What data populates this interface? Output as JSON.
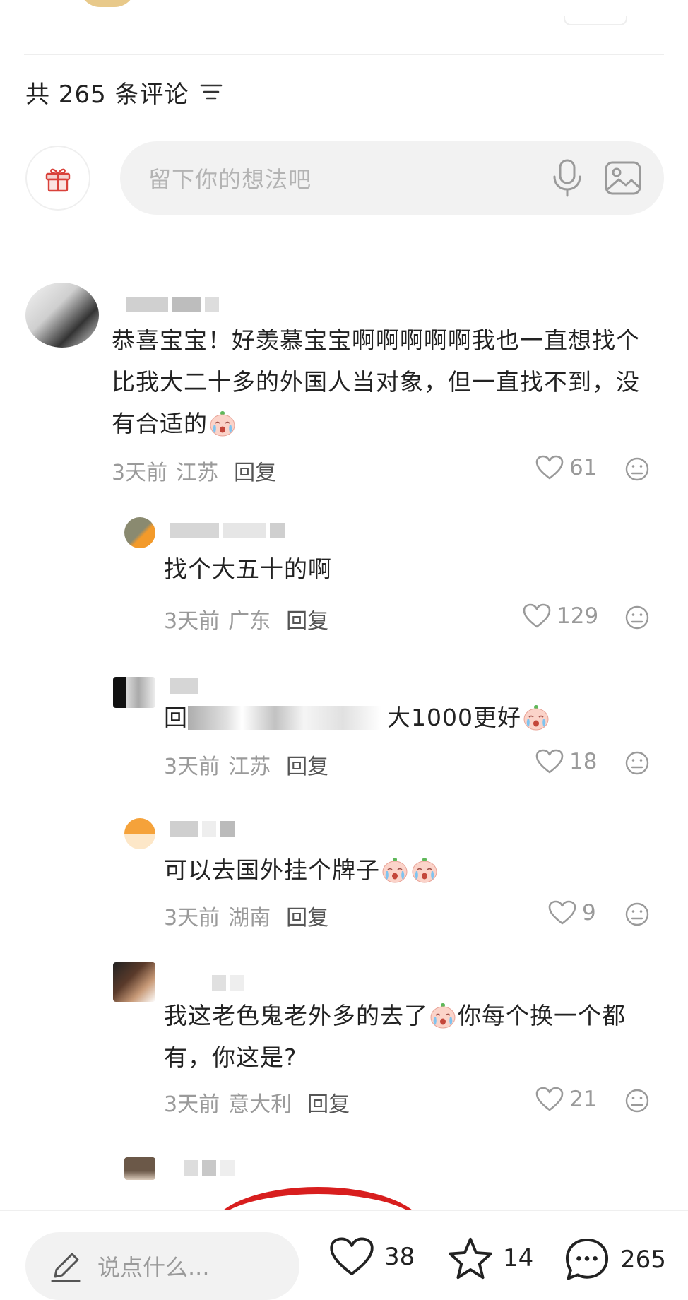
{
  "header": {
    "comment_count_label": "共 265 条评论"
  },
  "composer": {
    "placeholder": "留下你的想法吧"
  },
  "comments": [
    {
      "text": "恭喜宝宝！好羡慕宝宝啊啊啊啊啊我也一直想找个比我大二十多的外国人当对象，但一直找不到，没有合适的",
      "time": "3天前",
      "location": "江苏",
      "reply_label": "回复",
      "likes": "61"
    },
    {
      "text": "找个大五十的啊",
      "time": "3天前",
      "location": "广东",
      "reply_label": "回复",
      "likes": "129"
    },
    {
      "text_prefix": "回",
      "text": "大1000更好",
      "time": "3天前",
      "location": "江苏",
      "reply_label": "回复",
      "likes": "18"
    },
    {
      "text": "可以去国外挂个牌子",
      "time": "3天前",
      "location": "湖南",
      "reply_label": "回复",
      "likes": "9"
    },
    {
      "text_a": "我这老色鬼老外多的去了",
      "text_b": "你每个换一个都有，你这是?",
      "time": "3天前",
      "location": "意大利",
      "reply_label": "回复",
      "likes": "21"
    }
  ],
  "bottom_bar": {
    "input_placeholder": "说点什么...",
    "likes": "38",
    "favorites": "14",
    "comments": "265"
  },
  "colors": {
    "accent_red": "#d81e1e",
    "muted": "#9a9a9a",
    "input_bg": "#f2f2f2"
  },
  "icons": [
    "sort-icon",
    "gift-icon",
    "mic-icon",
    "image-icon",
    "heart-icon",
    "meh-face-icon",
    "emoji-crying-icon",
    "pencil-icon",
    "star-icon",
    "chat-bubble-icon"
  ]
}
